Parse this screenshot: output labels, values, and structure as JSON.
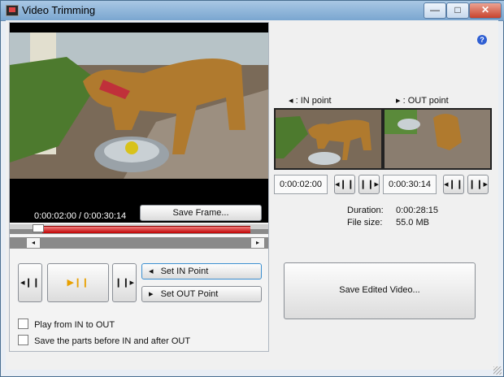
{
  "window": {
    "title": "Video Trimming",
    "minimize_glyph": "—",
    "maximize_glyph": "□",
    "close_glyph": "✕",
    "help_glyph": "?"
  },
  "player": {
    "time_readout": "0:00:02:00 / 0:00:30:14",
    "save_frame_label": "Save Frame...",
    "in_marker_glyph": "◂",
    "out_marker_glyph": "▸",
    "step_back_glyph": "◂❙❙",
    "play_pause_glyph": "▶❙❙",
    "step_forward_glyph": "❙❙▸",
    "set_in_label": "Set IN Point",
    "set_in_glyph": "◂",
    "set_out_label": "Set OUT Point",
    "set_out_glyph": "▸",
    "play_in_out_label": "Play from IN to OUT",
    "save_parts_label": "Save the parts before IN and after OUT",
    "in_fraction": 0.065,
    "out_fraction": 1.0
  },
  "points": {
    "in_label": ": IN point",
    "out_label": ": OUT point",
    "in_time": "0:00:02:00",
    "out_time": "0:00:30:14",
    "step_back_glyph": "◂❙❙",
    "step_forward_glyph": "❙❙▸"
  },
  "info": {
    "duration_label": "Duration:",
    "duration_value": "0:00:28:15",
    "filesize_label": "File size:",
    "filesize_value": "55.0 MB"
  },
  "actions": {
    "save_video_label": "Save Edited Video..."
  },
  "colors": {
    "accent_red": "#c00000",
    "play_accent": "#e8a000",
    "help_blue": "#2f5fd3"
  }
}
